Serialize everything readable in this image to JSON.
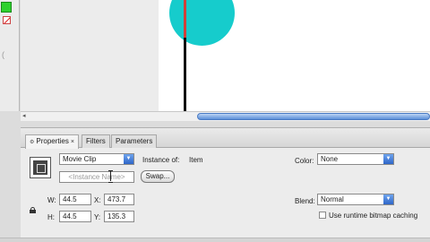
{
  "toolbar": {
    "fill_color": "#2fd12f",
    "stroke_icon": "no-color-icon"
  },
  "stage": {
    "circle_color": "#16cccc",
    "guide_color": "#d0403a"
  },
  "panel": {
    "tabs": [
      {
        "label": "Properties",
        "icon": "properties-icon",
        "close": "×",
        "active": true
      },
      {
        "label": "Filters",
        "active": false
      },
      {
        "label": "Parameters",
        "active": false
      }
    ],
    "symbol_type": "Movie Clip",
    "instance_of_label": "Instance of:",
    "instance_of_value": "Item",
    "instance_name_placeholder": "<Instance Name>",
    "swap_label": "Swap...",
    "w_label": "W:",
    "w_value": "44.5",
    "h_label": "H:",
    "h_value": "44.5",
    "x_label": "X:",
    "x_value": "473.7",
    "y_label": "Y:",
    "y_value": "135.3",
    "color_label": "Color:",
    "color_value": "None",
    "blend_label": "Blend:",
    "blend_value": "Normal",
    "cache_label": "Use runtime bitmap caching"
  },
  "colors": {
    "scroll_thumb": "#5c8fd8",
    "dropdown_arrow": "#2e66c8"
  }
}
